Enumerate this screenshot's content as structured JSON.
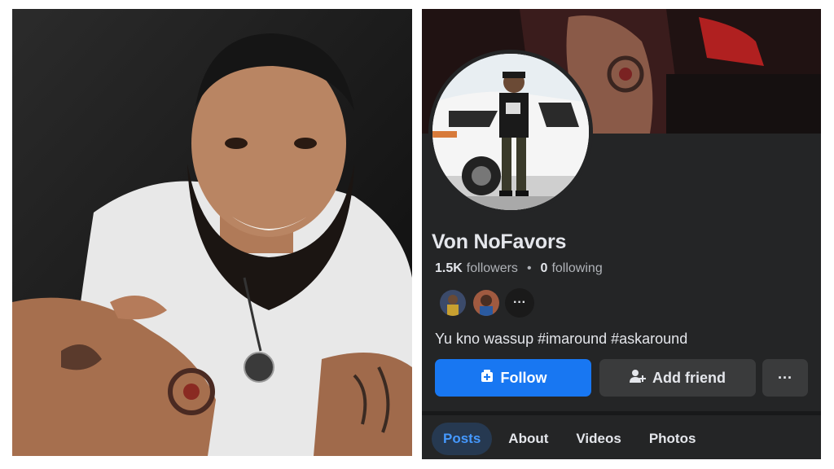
{
  "profile": {
    "name": "Von NoFavors",
    "followers_count": "1.5K",
    "followers_label": "followers",
    "separator": "•",
    "following_count": "0",
    "following_label": "following",
    "bio": "Yu kno wassup #imaround #askaround",
    "mutual_more": "···"
  },
  "actions": {
    "follow_label": "Follow",
    "add_friend_label": "Add friend",
    "more_label": "···"
  },
  "tabs": [
    {
      "label": "Posts",
      "active": true
    },
    {
      "label": "About",
      "active": false
    },
    {
      "label": "Videos",
      "active": false
    },
    {
      "label": "Photos",
      "active": false
    }
  ],
  "colors": {
    "accent": "#1877f2",
    "panel_bg": "#242526",
    "secondary_button": "#3a3b3c",
    "active_tab_bg": "#263951",
    "active_tab_text": "#4599ff"
  },
  "icons": {
    "follow": "follow-plus-icon",
    "add_friend": "person-add-icon",
    "more": "ellipsis-icon"
  }
}
